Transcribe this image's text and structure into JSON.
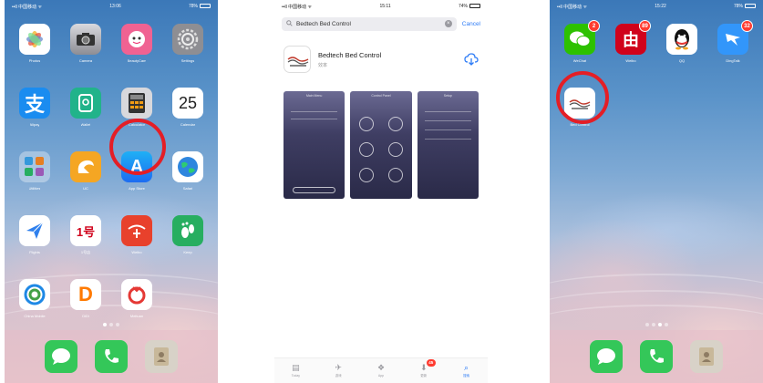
{
  "left_phone": {
    "status": {
      "carrier": "••ll 中国移动 ᯤ",
      "time": "13:06",
      "battery": "78%"
    },
    "apps": [
      {
        "label": "Photos",
        "icon": "photos-icon"
      },
      {
        "label": "Camera",
        "icon": "camera-icon"
      },
      {
        "label": "BeautyCam",
        "icon": "beautycam-icon"
      },
      {
        "label": "Settings",
        "icon": "settings-icon"
      },
      {
        "label": "Alipay",
        "icon": "alipay-icon"
      },
      {
        "label": "Wallet",
        "icon": "wallet-icon"
      },
      {
        "label": "Calculator",
        "icon": "calculator-icon"
      },
      {
        "label": "Calendar",
        "icon": "calendar-icon",
        "glyph": "25"
      },
      {
        "label": "Utilities",
        "icon": "utilities-folder-icon"
      },
      {
        "label": "UC",
        "icon": "uc-browser-icon"
      },
      {
        "label": "App Store",
        "icon": "app-store-icon",
        "glyph": "A"
      },
      {
        "label": "Safari",
        "icon": "globe-icon"
      },
      {
        "label": "Flights",
        "icon": "paper-plane-icon"
      },
      {
        "label": "1号店",
        "icon": "shop-188-icon",
        "glyph": "1号"
      },
      {
        "label": "Weibo",
        "icon": "weibo-icon"
      },
      {
        "label": "Keep",
        "icon": "footprint-icon"
      },
      {
        "label": "China Mobile",
        "icon": "china-mobile-icon"
      },
      {
        "label": "DiDi",
        "icon": "didi-icon",
        "glyph": "D"
      },
      {
        "label": "Meituan",
        "icon": "meituan-icon"
      }
    ],
    "dock": [
      "messages-icon",
      "phone-icon",
      "contacts-icon"
    ]
  },
  "middle_phone": {
    "status": {
      "carrier": "••ll 中国移动 ᯤ",
      "time": "15:11",
      "battery": "74%"
    },
    "search": {
      "query": "Bedtech Bed Control",
      "cancel": "Cancel"
    },
    "result": {
      "title": "Bedtech Bed Control",
      "subtitle": "效率"
    },
    "screenshots": [
      {
        "title": "Main Menu",
        "rows": []
      },
      {
        "title": "Control Panel",
        "rows": []
      },
      {
        "title": "Setup",
        "rows": []
      }
    ],
    "tabs": [
      {
        "label": "Today",
        "glyph": "▤"
      },
      {
        "label": "游戏",
        "glyph": "✈"
      },
      {
        "label": "App",
        "glyph": "❖"
      },
      {
        "label": "更新",
        "glyph": "⬇",
        "badge": "45"
      },
      {
        "label": "搜索",
        "glyph": "⌕",
        "active": true
      }
    ]
  },
  "right_phone": {
    "status": {
      "carrier": "••ll 中国移动 ᯤ",
      "time": "15:22",
      "battery": "78%"
    },
    "apps": [
      {
        "label": "WeChat",
        "icon": "wechat-icon",
        "badge": "2"
      },
      {
        "label": "Weibo",
        "icon": "toutiao-icon",
        "badge": "89",
        "glyph": "由"
      },
      {
        "label": "QQ",
        "icon": "qq-icon"
      },
      {
        "label": "DingTalk",
        "icon": "dingtalk-icon",
        "badge": "32"
      },
      {
        "label": "Bed Control",
        "icon": "bedtech-app-icon"
      }
    ],
    "dock": [
      "messages-icon",
      "phone-icon",
      "contacts-icon"
    ]
  },
  "colors": {
    "highlight_ring": "#e41e26",
    "accent": "#2e7cf6",
    "badge": "#ff3b30"
  }
}
